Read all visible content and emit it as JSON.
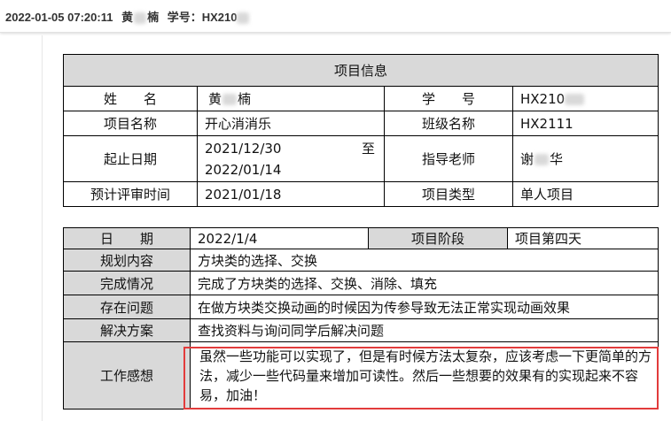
{
  "topbar": {
    "datetime": "2022-01-05 07:20:11",
    "name_part1": "黄",
    "name_part2": "楠",
    "id_label": "学号：",
    "id_value": "HX210"
  },
  "project_info": {
    "title": "项目信息",
    "name_label": "姓　　名",
    "name_part1": "黄",
    "name_part2": "楠",
    "student_id_label": "学　　号",
    "student_id_value": "HX210",
    "project_name_label": "项目名称",
    "project_name_value": "开心消消乐",
    "class_label": "班级名称",
    "class_value": "HX2111",
    "date_range_label": "起止日期",
    "date_start": "2021/12/30",
    "date_to": "至",
    "date_end": "2022/01/14",
    "advisor_label": "指导老师",
    "advisor_part1": "谢",
    "advisor_part2": "华",
    "review_label": "预计评审时间",
    "review_value": "2021/01/18",
    "type_label": "项目类型",
    "type_value": "单人项目"
  },
  "daily_log": {
    "date_label": "日　　期",
    "date_value": "2022/1/4",
    "stage_label": "项目阶段",
    "stage_value": "项目第四天",
    "plan_label": "规划内容",
    "plan_value": "方块类的选择、交换",
    "done_label": "完成情况",
    "done_value": "完成了方块类的选择、交换、消除、填充",
    "issue_label": "存在问题",
    "issue_value": "在做方块类交换动画的时候因为传参导致无法正常实现动画效果",
    "solution_label": "解决方案",
    "solution_value": "查找资料与询问同学后解决问题",
    "feedback_label": "工作感想",
    "feedback_value": "虽然一些功能可以实现了，但是有时候方法太复杂，应该考虑一下更简单的方法，减少一些代码量来增加可读性。然后一些想要的效果有的实现起来不容易，加油！"
  },
  "colors": {
    "header_grey": "#d9d9d9",
    "highlight_red": "#e23b3b"
  }
}
